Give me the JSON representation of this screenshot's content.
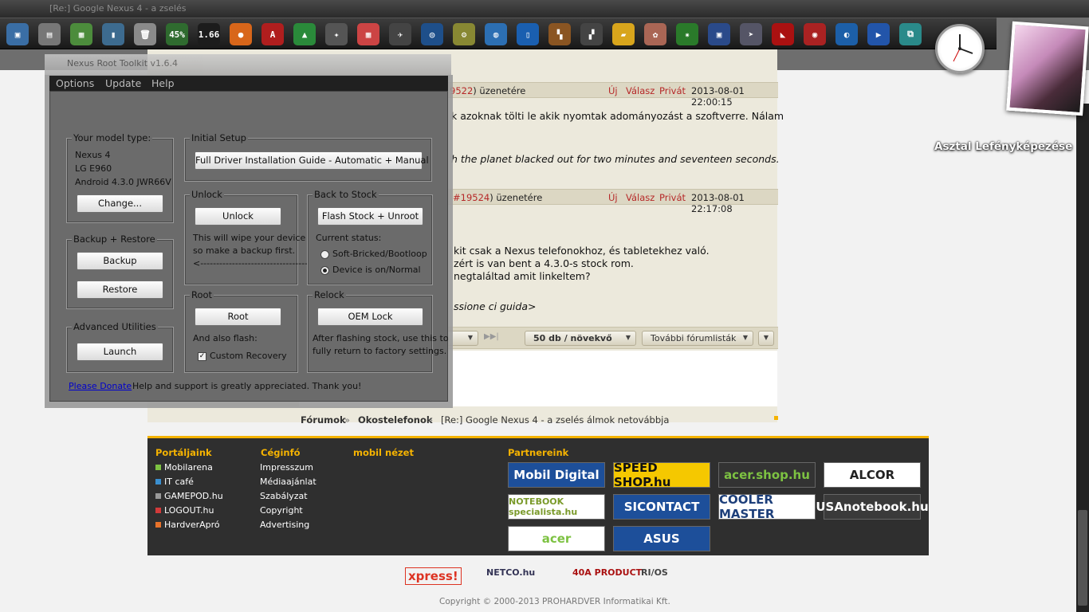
{
  "window": {
    "title": "[Re:] Google Nexus 4 - a zselés",
    "toolkit_title": "Nexus Root Toolkit v1.6.4"
  },
  "dock": {
    "icons": [
      {
        "name": "computer-icon",
        "color": "#3a6ea5",
        "glyph": "▣"
      },
      {
        "name": "scanner-icon",
        "color": "#777",
        "glyph": "▤"
      },
      {
        "name": "wallpaper-icon",
        "color": "#4c8c3c",
        "glyph": "▦"
      },
      {
        "name": "usb-drive-icon",
        "color": "#3d6b8f",
        "glyph": "▮"
      },
      {
        "name": "recycle-bin-icon",
        "color": "#8a8a8a",
        "glyph": "🗑"
      },
      {
        "name": "cpu-meter-icon",
        "color": "#2f6b2f",
        "glyph": "45%"
      },
      {
        "name": "memory-meter-icon",
        "color": "#1c1c1c",
        "glyph": "1.66"
      },
      {
        "name": "firefox-icon",
        "color": "#d8661a",
        "glyph": "●"
      },
      {
        "name": "acrobat-icon",
        "color": "#b01e1e",
        "glyph": "A"
      },
      {
        "name": "google-drive-icon",
        "color": "#2a8a3a",
        "glyph": "▲"
      },
      {
        "name": "color-picker-icon",
        "color": "#555",
        "glyph": "✦"
      },
      {
        "name": "calculator-icon",
        "color": "#c44",
        "glyph": "▦"
      },
      {
        "name": "airplane-icon",
        "color": "#444",
        "glyph": "✈"
      },
      {
        "name": "headphones-icon",
        "color": "#1e4f8a",
        "glyph": "◎"
      },
      {
        "name": "tools-icon",
        "color": "#883",
        "glyph": "⚙"
      },
      {
        "name": "globe-icon",
        "color": "#2c6fb3",
        "glyph": "◍"
      },
      {
        "name": "phone-icon",
        "color": "#1a5fb0",
        "glyph": "▯"
      },
      {
        "name": "grid-icon",
        "color": "#8a5522",
        "glyph": "▚"
      },
      {
        "name": "network-icon",
        "color": "#444",
        "glyph": "▞"
      },
      {
        "name": "folder-icon",
        "color": "#d8a51c",
        "glyph": "▰"
      },
      {
        "name": "gimp-icon",
        "color": "#a65",
        "glyph": "✿"
      },
      {
        "name": "pinwheel-icon",
        "color": "#2a7a2a",
        "glyph": "✷"
      },
      {
        "name": "floppy-icon",
        "color": "#2a4a8a",
        "glyph": "▣"
      },
      {
        "name": "paper-plane-icon",
        "color": "#556",
        "glyph": "➤"
      },
      {
        "name": "red-eye-icon",
        "color": "#a11",
        "glyph": "◣"
      },
      {
        "name": "phone-red-icon",
        "color": "#a22",
        "glyph": "◉"
      },
      {
        "name": "world-icon",
        "color": "#1c5fa8",
        "glyph": "◐"
      },
      {
        "name": "media-player-icon",
        "color": "#2255aa",
        "glyph": "▶"
      },
      {
        "name": "map-icon",
        "color": "#2a8a8a",
        "glyph": "⧉"
      }
    ]
  },
  "widgets": {
    "photo_caption": "Asztal Lefényképezése"
  },
  "forum": {
    "post1": {
      "num": "9522",
      "suffix": ") üzenetére",
      "actions": [
        "Új",
        "Válasz",
        "Privát"
      ],
      "date": "2013-08-01 22:00:15",
      "text": "k azoknak tölti le akik nyomtak adományozást a szoftverre. Nálam",
      "sig": "h the planet blacked out for two minutes and seventeen seconds."
    },
    "post2": {
      "num": "#19524",
      "suffix": ") üzenetére",
      "actions": [
        "Új",
        "Válasz",
        "Privát"
      ],
      "date": "2013-08-01 22:17:08",
      "lines": [
        "kit csak a Nexus telefonokhoz, és tabletekhez való.",
        "zért is van bent a 4.3.0-s stock rom.",
        "negtaláltad amit linkeltem?"
      ],
      "sig": "ssione ci guida>"
    },
    "pager": {
      "per_page": "50 db / növekvő",
      "more": "További fórumlisták"
    },
    "breadcrumb": {
      "c1": "Fórumok",
      "c2": "Okostelefonok",
      "c3": "[Re:] Google Nexus 4 - a zselés álmok netovábbja",
      "sep": "»"
    }
  },
  "footer": {
    "col1": {
      "title": "Portáljaink",
      "items": [
        {
          "label": "Mobilarena",
          "color": "#7dc242"
        },
        {
          "label": "IT café",
          "color": "#3a8fd0"
        },
        {
          "label": "GAMEPOD.hu",
          "color": "#999999"
        },
        {
          "label": "LOGOUT.hu",
          "color": "#d23a3a"
        },
        {
          "label": "HardverApró",
          "color": "#e8722a"
        }
      ]
    },
    "col2": {
      "title": "Céginfó",
      "items": [
        "Impresszum",
        "Médiaajánlat",
        "Szabályzat",
        "Copyright",
        "Advertising"
      ]
    },
    "col3": {
      "title": "mobil nézet"
    },
    "col4": {
      "title": "Partnereink",
      "partners": [
        {
          "label": "Mobil Digital",
          "bg": "#1d4f9a",
          "fg": "#ffffff"
        },
        {
          "label": "SPEED SHOP.hu",
          "bg": "#f5c800",
          "fg": "#111111"
        },
        {
          "label": "acer.shop.hu",
          "bg": "#333333",
          "fg": "#7dc242"
        },
        {
          "label": "ALCOR",
          "bg": "#ffffff",
          "fg": "#222222"
        },
        {
          "label": "NOTEBOOK specialista.hu",
          "bg": "#ffffff",
          "fg": "#7a9a2a"
        },
        {
          "label": "SICONTACT",
          "bg": "#1d4f9a",
          "fg": "#ffffff"
        },
        {
          "label": "COOLER MASTER",
          "bg": "#ffffff",
          "fg": "#1d3f7a"
        },
        {
          "label": "USAnotebook.hu",
          "bg": "#3a3a3a",
          "fg": "#ffffff"
        },
        {
          "label": "acer",
          "bg": "#ffffff",
          "fg": "#7dc242"
        },
        {
          "label": "ASUS",
          "bg": "#1d4f9a",
          "fg": "#ffffff"
        }
      ]
    },
    "bottom_logos": [
      "xpress!",
      "NETCO.hu",
      "40A PRODUCT",
      "RI/OS"
    ],
    "copyright": "Copyright © 2000-2013 PROHARDVER Informatikai Kft."
  },
  "toolkit": {
    "menu": [
      "Options",
      "Update",
      "Help"
    ],
    "model": {
      "title": "Your model type:",
      "device": "Nexus 4",
      "model": "LG E960",
      "android": "Android 4.3.0 JWR66V",
      "change_btn": "Change..."
    },
    "initial": {
      "title": "Initial Setup",
      "btn": "Full Driver Installation Guide - Automatic + Manual"
    },
    "backup": {
      "title": "Backup + Restore",
      "backup_btn": "Backup",
      "restore_btn": "Restore"
    },
    "unlock": {
      "title": "Unlock",
      "btn": "Unlock",
      "note1": "This will wipe your device",
      "note2": "so make a backup first.",
      "arrow": "<----------------------------------"
    },
    "stock": {
      "title": "Back to Stock",
      "btn": "Flash Stock + Unroot",
      "status_label": "Current status:",
      "opt1": "Soft-Bricked/Bootloop",
      "opt2": "Device is on/Normal"
    },
    "advanced": {
      "title": "Advanced Utilities",
      "btn": "Launch"
    },
    "root": {
      "title": "Root",
      "btn": "Root",
      "also": "And also flash:",
      "custom": "Custom Recovery"
    },
    "relock": {
      "title": "Relock",
      "btn": "OEM Lock",
      "note1": "After flashing stock, use this to",
      "note2": "fully return to factory settings."
    },
    "donate": {
      "link": "Please Donate",
      "text": "Help and support is greatly appreciated. Thank you!"
    }
  }
}
